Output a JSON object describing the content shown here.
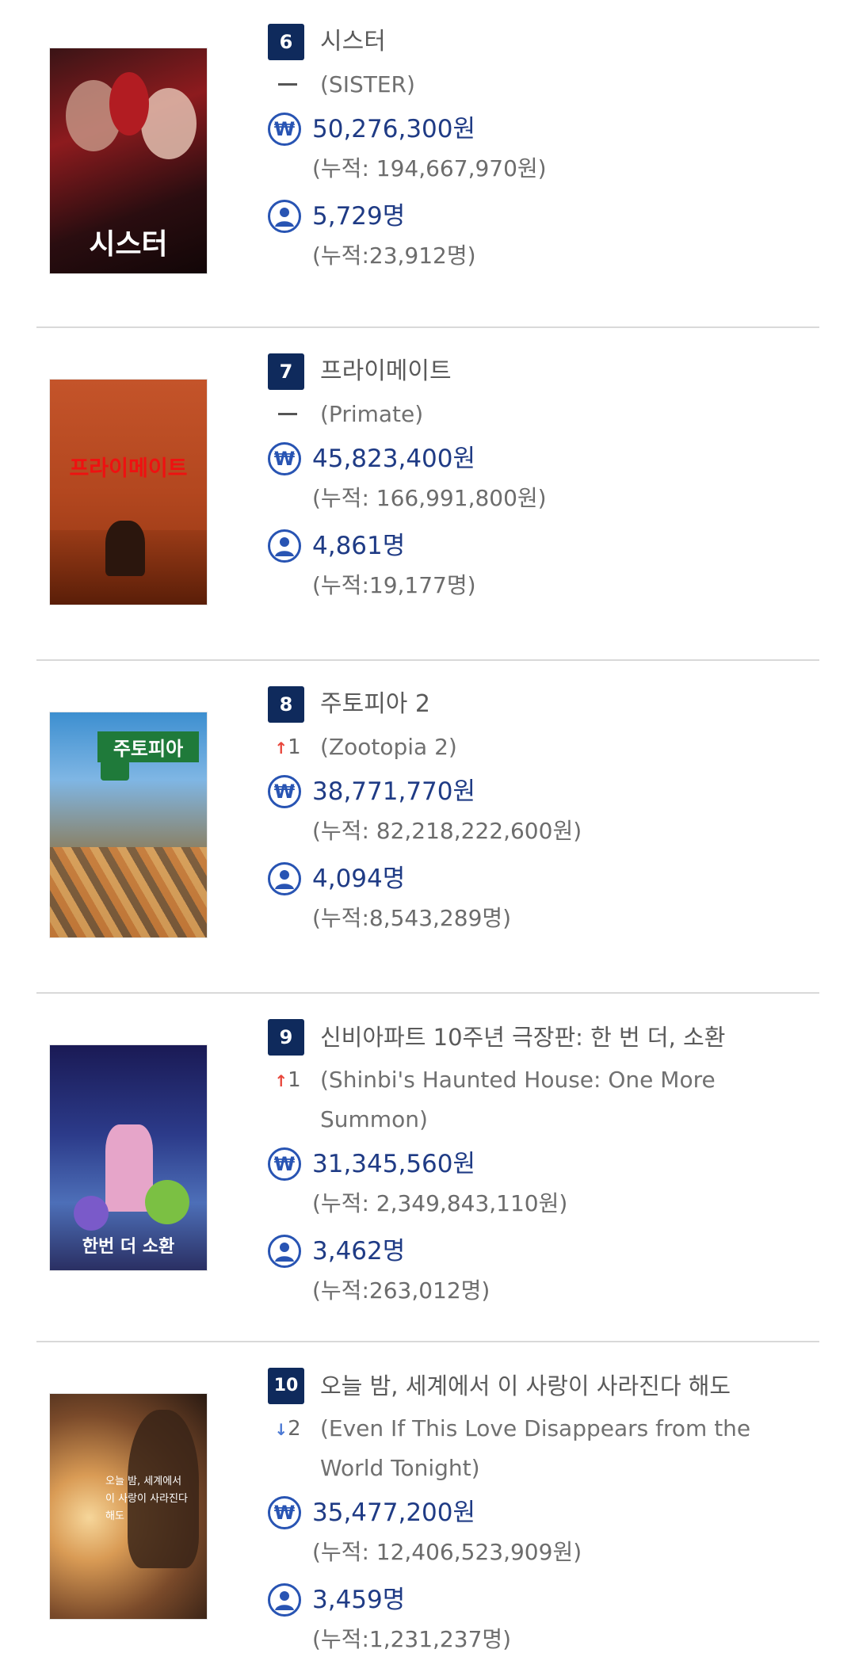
{
  "movies": [
    {
      "rank": "6",
      "title": "시스터",
      "rank_change": "",
      "change_dir": "none",
      "original_title": "(SISTER)",
      "sales": "50,276,300원",
      "sales_cum": "(누적: 194,667,970원)",
      "audience": "5,729명",
      "audience_cum": "(누적:23,912명)",
      "poster_text": "시스터"
    },
    {
      "rank": "7",
      "title": "프라이메이트",
      "rank_change": "",
      "change_dir": "none",
      "original_title": "(Primate)",
      "sales": "45,823,400원",
      "sales_cum": "(누적: 166,991,800원)",
      "audience": "4,861명",
      "audience_cum": "(누적:19,177명)",
      "poster_text": "프라이메이트"
    },
    {
      "rank": "8",
      "title": "주토피아 2",
      "rank_change": "1",
      "change_dir": "up",
      "original_title": "(Zootopia 2)",
      "sales": "38,771,770원",
      "sales_cum": "(누적: 82,218,222,600원)",
      "audience": "4,094명",
      "audience_cum": "(누적:8,543,289명)",
      "poster_text": "주토피아"
    },
    {
      "rank": "9",
      "title": "신비아파트 10주년 극장판: 한 번 더, 소환",
      "rank_change": "1",
      "change_dir": "up",
      "original_title": "(Shinbi's Haunted House: One More Summon)",
      "sales": "31,345,560원",
      "sales_cum": "(누적: 2,349,843,110원)",
      "audience": "3,462명",
      "audience_cum": "(누적:263,012명)",
      "poster_text": "한번 더 소환"
    },
    {
      "rank": "10",
      "title": "오늘 밤, 세계에서 이 사랑이 사라진다 해도",
      "rank_change": "2",
      "change_dir": "down",
      "original_title": "(Even If This Love Disappears from the World Tonight)",
      "sales": "35,477,200원",
      "sales_cum": "(누적: 12,406,523,909원)",
      "audience": "3,459명",
      "audience_cum": "(누적:1,231,237명)",
      "poster_text": "오늘 밤, 세계에서 이 사랑이 사라진다 해도"
    }
  ],
  "icons": {
    "sales": "won-icon",
    "audience": "person-icon",
    "up": "arrow-up-icon",
    "down": "arrow-down-icon",
    "flat": "dash-icon"
  },
  "colors": {
    "badge": "#0f2a5c",
    "metric": "#1f3b85",
    "icon": "#2854b3",
    "up": "#e8463b",
    "down": "#4a78d4"
  }
}
